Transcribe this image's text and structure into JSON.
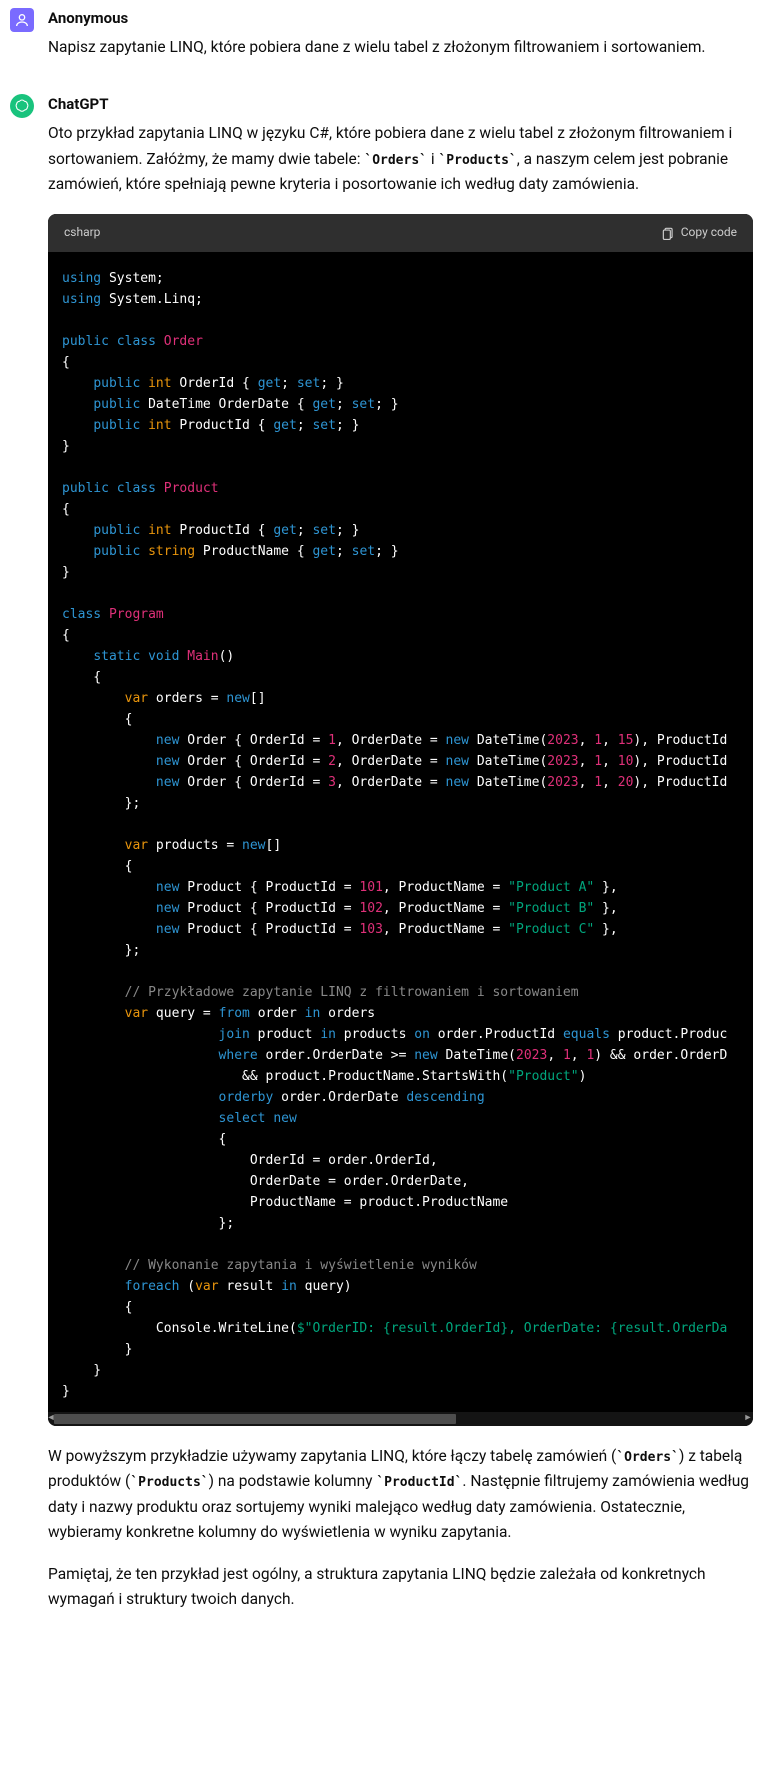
{
  "user": {
    "author": "Anonymous",
    "text": "Napisz zapytanie LINQ, które pobiera dane z wielu tabel z złożonym filtrowaniem i sortowaniem."
  },
  "assistant": {
    "author": "ChatGPT",
    "intro_pre": "Oto przykład zapytania LINQ w języku C#, które pobiera dane z wielu tabel z złożonym filtrowaniem i sortowaniem. Załóżmy, że mamy dwie tabele: ",
    "intro_code1": "`Orders`",
    "intro_mid1": " i ",
    "intro_code2": "`Products`",
    "intro_post": ", a naszym celem jest pobranie zamówień, które spełniają pewne kryteria i posortowanie ich według daty zamówienia.",
    "outro1_a": "W powyższym przykładzie używamy zapytania LINQ, które łączy tabelę zamówień (",
    "outro1_c1": "`Orders`",
    "outro1_b": ") z tabelą produktów (",
    "outro1_c2": "`Products`",
    "outro1_c": ") na podstawie kolumny ",
    "outro1_c3": "`ProductId`",
    "outro1_d": ". Następnie filtrujemy zamówienia według daty i nazwy produktu oraz sortujemy wyniki malejąco według daty zamówienia. Ostatecznie, wybieramy konkretne kolumny do wyświetlenia w wyniku zapytania.",
    "outro2": "Pamiętaj, że ten przykład jest ogólny, a struktura zapytania LINQ będzie zależała od konkretnych wymagań i struktury twoich danych."
  },
  "code": {
    "lang": "csharp",
    "copy": "Copy code",
    "l1a": "using",
    "l1b": " System;",
    "l2a": "using",
    "l2b": " System.Linq;",
    "l3a": "public",
    "l3b": "class",
    "l3c": "Order",
    "l4": "{",
    "l5a": "public",
    "l5b": "int",
    "l5c": " OrderId { ",
    "l5d": "get",
    "l5e": "; ",
    "l5f": "set",
    "l5g": "; }",
    "l6a": "public",
    "l6b": " DateTime OrderDate { ",
    "l6c": "get",
    "l6d": "; ",
    "l6e": "set",
    "l6f": "; }",
    "l7a": "public",
    "l7b": "int",
    "l7c": " ProductId { ",
    "l7d": "get",
    "l7e": "; ",
    "l7f": "set",
    "l7g": "; }",
    "l8": "}",
    "l9a": "public",
    "l9b": "class",
    "l9c": "Product",
    "l10": "{",
    "l11a": "public",
    "l11b": "int",
    "l11c": " ProductId { ",
    "l11d": "get",
    "l11e": "; ",
    "l11f": "set",
    "l11g": "; }",
    "l12a": "public",
    "l12b": "string",
    "l12c": " ProductName { ",
    "l12d": "get",
    "l12e": "; ",
    "l12f": "set",
    "l12g": "; }",
    "l13": "}",
    "l14a": "class",
    "l14b": "Program",
    "l15": "{",
    "l16a": "static",
    "l16b": "void",
    "l16c": "Main",
    "l16d": "()",
    "l17": "    {",
    "l18a": "var",
    "l18b": " orders = ",
    "l18c": "new",
    "l18d": "[]",
    "l19": "        {",
    "l20a": "new",
    "l20b": " Order { OrderId = ",
    "l20c": "1",
    "l20d": ", OrderDate = ",
    "l20e": "new",
    "l20f": " DateTime(",
    "l20g": "2023",
    "l20h": ", ",
    "l20i": "1",
    "l20j": ", ",
    "l20k": "15",
    "l20l": "), ProductId",
    "l21a": "new",
    "l21b": " Order { OrderId = ",
    "l21c": "2",
    "l21d": ", OrderDate = ",
    "l21e": "new",
    "l21f": " DateTime(",
    "l21g": "2023",
    "l21h": ", ",
    "l21i": "1",
    "l21j": ", ",
    "l21k": "10",
    "l21l": "), ProductId",
    "l22a": "new",
    "l22b": " Order { OrderId = ",
    "l22c": "3",
    "l22d": ", OrderDate = ",
    "l22e": "new",
    "l22f": " DateTime(",
    "l22g": "2023",
    "l22h": ", ",
    "l22i": "1",
    "l22j": ", ",
    "l22k": "20",
    "l22l": "), ProductId",
    "l23": "        };",
    "l24a": "var",
    "l24b": " products = ",
    "l24c": "new",
    "l24d": "[]",
    "l25": "        {",
    "l26a": "new",
    "l26b": " Product { ProductId = ",
    "l26c": "101",
    "l26d": ", ProductName = ",
    "l26e": "\"Product A\"",
    "l26f": " },",
    "l27a": "new",
    "l27b": " Product { ProductId = ",
    "l27c": "102",
    "l27d": ", ProductName = ",
    "l27e": "\"Product B\"",
    "l27f": " },",
    "l28a": "new",
    "l28b": " Product { ProductId = ",
    "l28c": "103",
    "l28d": ", ProductName = ",
    "l28e": "\"Product C\"",
    "l28f": " },",
    "l29": "        };",
    "l30": "// Przykładowe zapytanie LINQ z filtrowaniem i sortowaniem",
    "l31a": "var",
    "l31b": " query = ",
    "l31c": "from",
    "l31d": " order ",
    "l31e": "in",
    "l31f": " orders",
    "l32a": "join",
    "l32b": " product ",
    "l32c": "in",
    "l32d": " products ",
    "l32e": "on",
    "l32f": " order.ProductId ",
    "l32g": "equals",
    "l32h": " product.Produc",
    "l33a": "where",
    "l33b": " order.OrderDate >= ",
    "l33c": "new",
    "l33d": " DateTime(",
    "l33e": "2023",
    "l33f": ", ",
    "l33g": "1",
    "l33h": ", ",
    "l33i": "1",
    "l33j": ") && order.OrderD",
    "l34a": "   && product.ProductName.StartsWith(",
    "l34b": "\"Product\"",
    "l34c": ")",
    "l35a": "orderby",
    "l35b": " order.OrderDate ",
    "l35c": "descending",
    "l36a": "select",
    "l36b": "new",
    "l37": "                    {",
    "l38": "                        OrderId = order.OrderId,",
    "l39": "                        OrderDate = order.OrderDate,",
    "l40": "                        ProductName = product.ProductName",
    "l41": "                    };",
    "l42": "// Wykonanie zapytania i wyświetlenie wyników",
    "l43a": "foreach",
    "l43b": " (",
    "l43c": "var",
    "l43d": " result ",
    "l43e": "in",
    "l43f": " query)",
    "l44": "        {",
    "l45a": "            Console.WriteLine(",
    "l45b": "$\"OrderID: ",
    "l45c": "{result.OrderId}",
    "l45d": ", OrderDate: ",
    "l45e": "{result.OrderDa",
    "l46": "        }",
    "l47": "    }",
    "l48": "}"
  }
}
